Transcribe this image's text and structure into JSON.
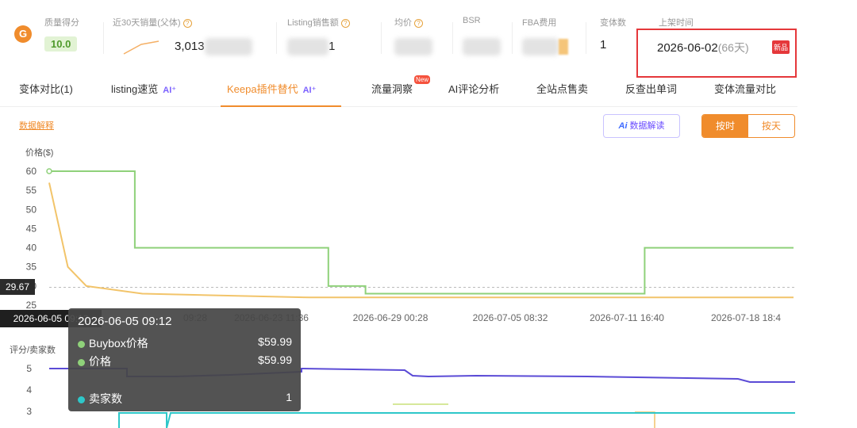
{
  "metrics": {
    "logo_glyph": "G",
    "quality_score": {
      "label": "质量得分",
      "value": "10.0"
    },
    "sales_30d": {
      "label": "近30天销量(父体)",
      "value": "3,013"
    },
    "listing_sales": {
      "label": "Listing销售额",
      "value": "1"
    },
    "avg_price": {
      "label": "均价"
    },
    "bsr": {
      "label": "BSR"
    },
    "fba_fee": {
      "label": "FBA费用"
    },
    "variants": {
      "label": "变体数",
      "value": "1"
    },
    "launch": {
      "label": "上架时间",
      "date": "2026-06-02",
      "days": "(66天)",
      "badge": "新品"
    },
    "help_glyph": "?"
  },
  "tabs": [
    {
      "label": "变体对比(1)"
    },
    {
      "label": "listing速览",
      "ai": "AI⁺"
    },
    {
      "label": "Keepa插件替代",
      "ai": "AI⁺",
      "active": true
    },
    {
      "label": "流量洞察",
      "badge": "New"
    },
    {
      "label": "AI评论分析"
    },
    {
      "label": "全站点售卖"
    },
    {
      "label": "反查出单词"
    },
    {
      "label": "变体流量对比"
    }
  ],
  "toolbar": {
    "data_explain": "数据解释",
    "ai_mark": "Ai",
    "ai_button": "数据解读",
    "by_hour": "按时",
    "by_day": "按天"
  },
  "chart_data": {
    "type": "line",
    "price_axis": {
      "title": "价格($)",
      "ticks": [
        "60",
        "55",
        "50",
        "45",
        "40",
        "35",
        "30",
        "25"
      ],
      "ylim": [
        25,
        60
      ]
    },
    "x_ticks": [
      "2026-06-05 09:12",
      "2026-06-23 11:36",
      "2026-06-29 00:28",
      "2026-07-05 08:32",
      "2026-07-11 16:40",
      "2026-07-18 18:4"
    ],
    "x_ticks_shown": [
      "09:28",
      "2026-06-23 11:36",
      "2026-06-29 00:28",
      "2026-07-05 08:32",
      "2026-07-11 16:40",
      "2026-07-18 18:4"
    ],
    "rating_axis": {
      "title": "评分/卖家数",
      "ticks": [
        "5",
        "4",
        "3"
      ]
    },
    "series": [
      {
        "name": "Buybox价格",
        "color": "#8fd17a",
        "values": [
          [
            0,
            60
          ],
          [
            0.23,
            60
          ],
          [
            0.23,
            40
          ],
          [
            0.75,
            40
          ],
          [
            0.75,
            30
          ],
          [
            0.85,
            30
          ],
          [
            0.85,
            28
          ],
          [
            1.6,
            28
          ],
          [
            1.6,
            40
          ],
          [
            2,
            40
          ]
        ]
      },
      {
        "name": "价格",
        "color": "#f2c46a",
        "values": [
          [
            0,
            57
          ],
          [
            0.05,
            35
          ],
          [
            0.1,
            30
          ],
          [
            0.25,
            28
          ],
          [
            0.7,
            27
          ],
          [
            2,
            27
          ]
        ]
      },
      {
        "name": "卖家数",
        "color": "#2ec7c9"
      }
    ],
    "crosshair": {
      "price_label": "29.67",
      "date_label": "2026-06-05 09:12"
    }
  },
  "tooltip": {
    "title": "2026-06-05 09:12",
    "rows": [
      {
        "name": "Buybox价格",
        "value": "$59.99",
        "color": "#8fd17a"
      },
      {
        "name": "价格",
        "value": "$59.99",
        "color": "#8fd17a"
      },
      {
        "name": "卖家数",
        "value": "1",
        "color": "#2ec7c9"
      }
    ]
  }
}
